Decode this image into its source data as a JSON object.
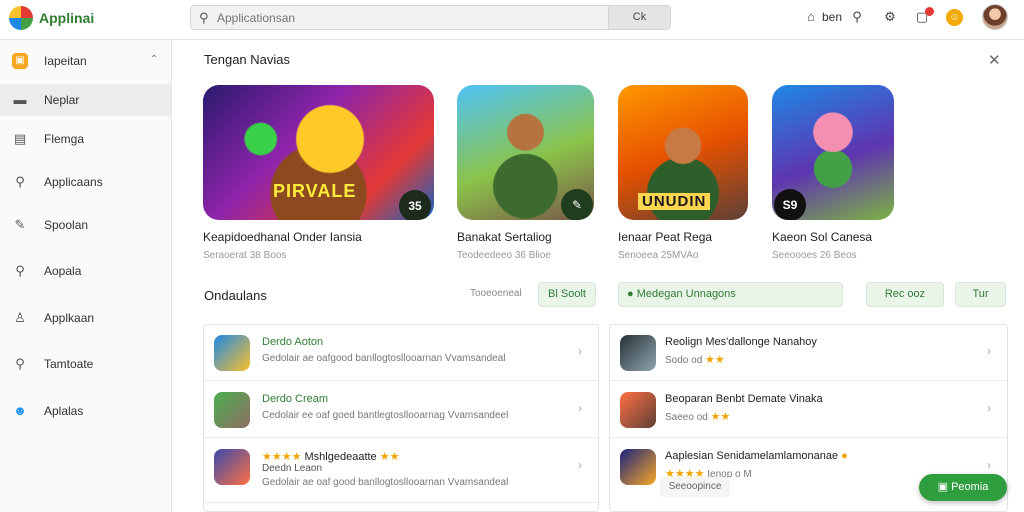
{
  "header": {
    "app_name": "Applinai",
    "search_placeholder": "Applicationsan",
    "search_button": "Ck",
    "nav_label": "ben",
    "coin_glyph": "☺"
  },
  "sidebar": {
    "items": [
      {
        "label": "Iapeitan",
        "icon": "bag-icon",
        "glyph": "▣"
      },
      {
        "label": "Neplar",
        "icon": "monitor-icon",
        "glyph": "▬"
      },
      {
        "label": "Flemga",
        "icon": "window-icon",
        "glyph": "▤"
      },
      {
        "label": "Applicaans",
        "icon": "search-icon",
        "glyph": "⚲"
      },
      {
        "label": "Spoolan",
        "icon": "edit-icon",
        "glyph": "✎"
      },
      {
        "label": "Aopala",
        "icon": "search-icon",
        "glyph": "⚲"
      },
      {
        "label": "Applkaan",
        "icon": "user-icon",
        "glyph": "♙"
      },
      {
        "label": "Tamtoate",
        "icon": "search-icon",
        "glyph": "⚲"
      },
      {
        "label": "Aplalas",
        "icon": "people-icon",
        "glyph": "☻"
      }
    ]
  },
  "featured": {
    "title": "Tengan Navias",
    "items": [
      {
        "title": "Keapidoedhanal Onder Iansia",
        "sub": "Seraoerat 38 Boos",
        "badge": "35",
        "overlay": "PIRVALE"
      },
      {
        "title": "Banakat Sertaliog",
        "sub": "Teodeedeeo 36 Blioe",
        "badge": "✎",
        "overlay": ""
      },
      {
        "title": "Ienaar Peat Rega",
        "sub": "Senoeea 25MVAo",
        "badge": "",
        "overlay": "UNUDIN"
      },
      {
        "title": "Kaeon Sol Canesa",
        "sub": "Seeoooes 26 Beos",
        "badge": "S9",
        "overlay": ""
      }
    ]
  },
  "ondaulans": {
    "title": "Ondaulans",
    "meta": "Tooeoeneal",
    "sort_label": "Bl Soolt",
    "filter_label": "Medegan Unnagons",
    "pills": [
      {
        "label": "Rec ooz"
      },
      {
        "label": "Tur"
      }
    ]
  },
  "list_left": [
    {
      "title": "Derdo Aoton",
      "sub": "Gedolair ae oafgood banllogtosllooarnan Vvamsandeal",
      "stars": ""
    },
    {
      "title": "Derdo Cream",
      "sub": "Cedolair ee oaf goed bantlegtosllooarnag Vvamsandeel",
      "stars": ""
    },
    {
      "title": "Mshlgedeaatte",
      "sub": "Deedn Leaon",
      "sub2": "Gedolair ae oaf good banllogtosllooarnan Vvamsandeal",
      "stars": "★★★★"
    }
  ],
  "list_right": [
    {
      "title": "Reolign Mes'dallonge Nanahoy",
      "sub": "Sodo od",
      "stars": "★★"
    },
    {
      "title": "Beoparan Benbt Demate Vinaka",
      "sub": "Saeeo od",
      "stars": "★★"
    },
    {
      "title": "Aaplesian Senidamelamlamonanae",
      "sub": "Ienop o M",
      "stars": "★★★★"
    }
  ],
  "tooltip": "Seeoopince",
  "float_button": "Peomia",
  "colors": {
    "accent": "#2e9e3f",
    "star": "#f0a500",
    "brand": "#2e7d32"
  }
}
